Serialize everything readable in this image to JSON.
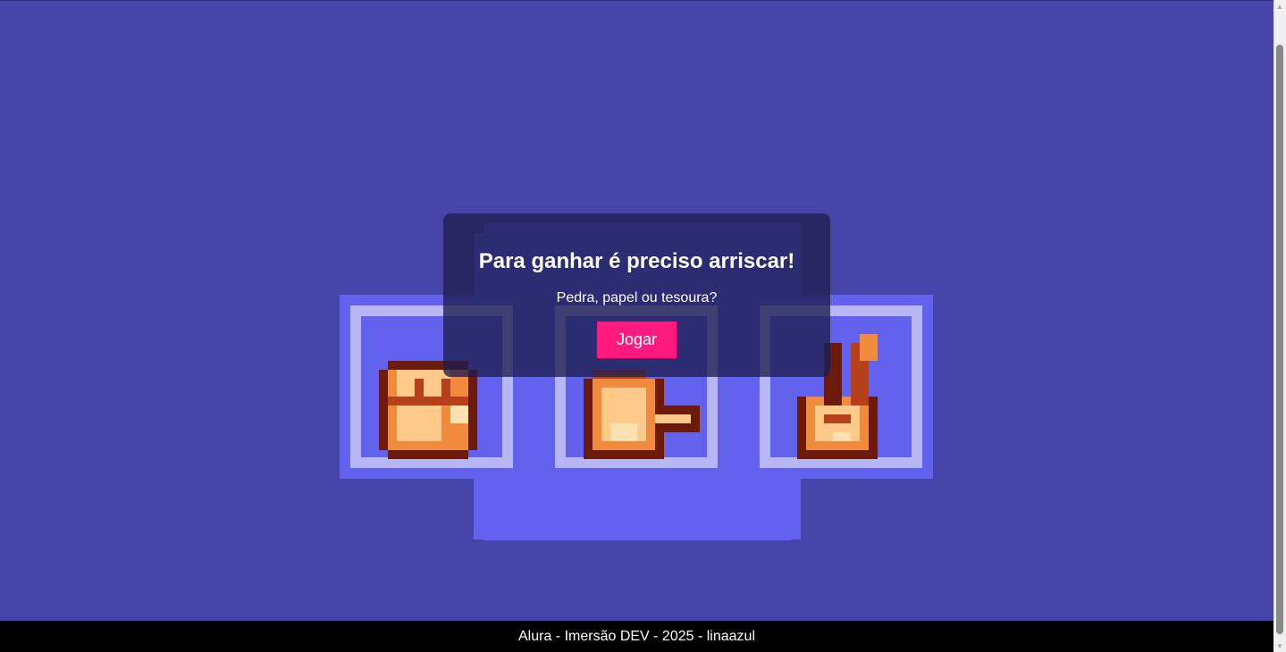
{
  "modal": {
    "title": "Para ganhar é preciso arriscar!",
    "subtitle": "Pedra, papel ou tesoura?",
    "play_label": "Jogar"
  },
  "cards": [
    {
      "name": "rock",
      "icon": "rock-hand-icon"
    },
    {
      "name": "paper",
      "icon": "paper-hand-icon"
    },
    {
      "name": "scissors",
      "icon": "scissors-hand-icon"
    }
  ],
  "footer": {
    "text": "Alura - Imersão DEV - 2025 - linaazul"
  },
  "colors": {
    "background": "#4646aa",
    "card": "#6262ee",
    "card_frame": "#b7b7f5",
    "button": "#ff1a7f",
    "skin_light": "#ffc98a",
    "skin_mid": "#f08a3c",
    "skin_dark": "#6b1a0c"
  }
}
